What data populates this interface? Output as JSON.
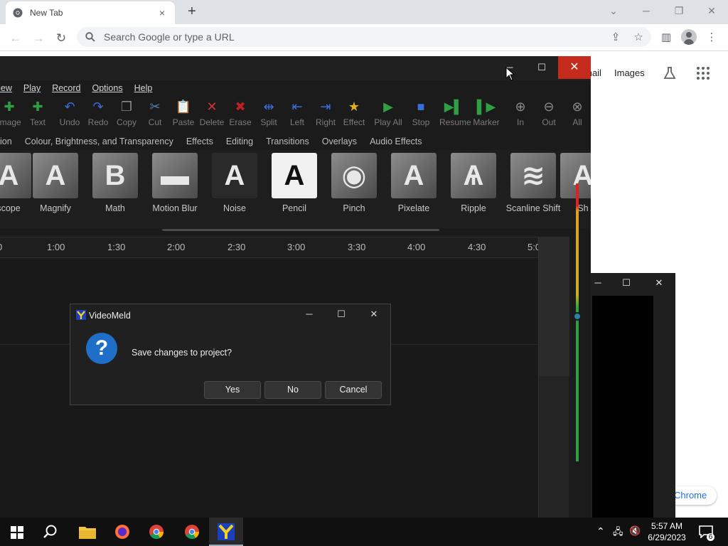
{
  "browser": {
    "tab_title": "New Tab",
    "tab_close": "×",
    "new_tab": "+",
    "omnibox_placeholder": "Search Google or type a URL",
    "links": {
      "gmail": "Gmail",
      "images": "Images"
    },
    "customize_chip": "Chrome"
  },
  "videomeld": {
    "menu": [
      {
        "label": "View"
      },
      {
        "label": "Play"
      },
      {
        "label": "Record"
      },
      {
        "label": "Options"
      },
      {
        "label": "Help"
      }
    ],
    "toolbar": [
      {
        "label": "Image",
        "icon": "image-icon",
        "color": "#2ea043"
      },
      {
        "label": "Text",
        "icon": "text-icon",
        "color": "#2ea043"
      },
      {
        "label": "Undo",
        "icon": "undo-icon",
        "color": "#3a6fd8"
      },
      {
        "label": "Redo",
        "icon": "redo-icon",
        "color": "#3a6fd8"
      },
      {
        "label": "Copy",
        "icon": "copy-icon",
        "color": "#9a9a9a"
      },
      {
        "label": "Cut",
        "icon": "cut-icon",
        "color": "#5a7fb0"
      },
      {
        "label": "Paste",
        "icon": "paste-icon",
        "color": "#9a9a9a"
      },
      {
        "label": "Delete",
        "icon": "delete-icon",
        "color": "#d23232"
      },
      {
        "label": "Erase",
        "icon": "erase-icon",
        "color": "#d23232"
      },
      {
        "label": "Split",
        "icon": "split-icon",
        "color": "#3a6fd8"
      },
      {
        "label": "Left",
        "icon": "left-icon",
        "color": "#3a6fd8"
      },
      {
        "label": "Right",
        "icon": "right-icon",
        "color": "#3a6fd8"
      },
      {
        "label": "Effect",
        "icon": "effect-star-icon",
        "color": "#e0b020"
      },
      {
        "label": "Play All",
        "icon": "play-all-icon",
        "color": "#2ea043"
      },
      {
        "label": "Stop",
        "icon": "stop-icon",
        "color": "#3a6fd8"
      },
      {
        "label": "Resume",
        "icon": "resume-icon",
        "color": "#2ea043"
      },
      {
        "label": "Marker",
        "icon": "marker-icon",
        "color": "#2ea043"
      },
      {
        "label": "In",
        "icon": "zoom-in-icon",
        "color": "#9a9a9a"
      },
      {
        "label": "Out",
        "icon": "zoom-out-icon",
        "color": "#9a9a9a"
      },
      {
        "label": "All",
        "icon": "zoom-all-icon",
        "color": "#9a9a9a"
      }
    ],
    "effect_tabs": [
      {
        "label": "ion"
      },
      {
        "label": "Colour, Brightness, and Transparency"
      },
      {
        "label": "Effects"
      },
      {
        "label": "Editing"
      },
      {
        "label": "Transitions"
      },
      {
        "label": "Overlays"
      },
      {
        "label": "Audio Effects"
      }
    ],
    "effects": [
      {
        "label": "scope",
        "glyph": "A"
      },
      {
        "label": "Magnify",
        "glyph": "A"
      },
      {
        "label": "Math",
        "glyph": "B"
      },
      {
        "label": "Motion Blur",
        "glyph": "▬"
      },
      {
        "label": "Noise",
        "glyph": "A"
      },
      {
        "label": "Pencil",
        "glyph": "A"
      },
      {
        "label": "Pinch",
        "glyph": "◉"
      },
      {
        "label": "Pixelate",
        "glyph": "A"
      },
      {
        "label": "Ripple",
        "glyph": "Ѧ"
      },
      {
        "label": "Scanline Shift",
        "glyph": "≋"
      },
      {
        "label": "Sh",
        "glyph": "A"
      }
    ],
    "timeline_ticks": [
      "0",
      "1:00",
      "1:30",
      "2:00",
      "2:30",
      "3:00",
      "3:30",
      "4:00",
      "4:30",
      "5:0"
    ]
  },
  "dialog": {
    "title": "VideoMeld",
    "message": "Save changes to project?",
    "buttons": {
      "yes": "Yes",
      "no": "No",
      "cancel": "Cancel"
    }
  },
  "taskbar": {
    "time": "5:57 AM",
    "date": "6/29/2023",
    "notification_count": "6"
  }
}
